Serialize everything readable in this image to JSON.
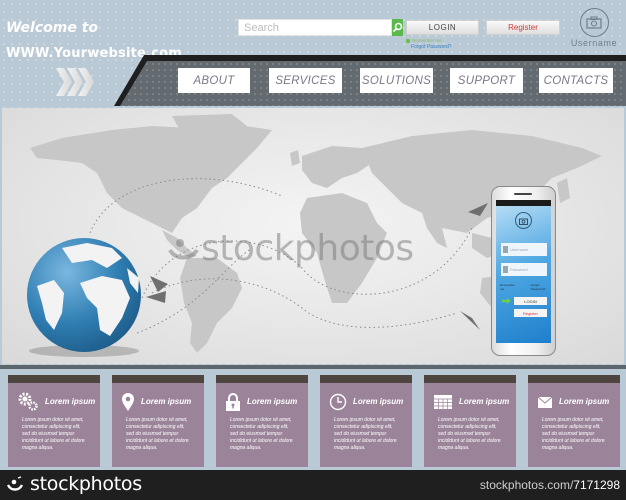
{
  "header": {
    "welcome": "Welcome to",
    "site": "WWW.Yourwebsite.com",
    "search_placeholder": "Search",
    "login_label": "LOGIN",
    "register_label": "Register",
    "remember_label": "Remember me",
    "forgot_label": "Forgot Password?",
    "username_label": "Username"
  },
  "nav": [
    {
      "label": "ABOUT"
    },
    {
      "label": "SERVICES"
    },
    {
      "label": "SOLUTIONS"
    },
    {
      "label": "SUPPORT"
    },
    {
      "label": "CONTACTS"
    }
  ],
  "hero": {
    "watermark": "stockphotos",
    "phone": {
      "username_placeholder": "Username",
      "password_placeholder": "Password",
      "remember_label": "Remember me",
      "forgot_label": "Forgot Password?",
      "login_label": "LOGIN",
      "register_label": "Register"
    }
  },
  "cards": [
    {
      "icon": "gears-icon",
      "title": "Lorem ipsum",
      "text": "Lorem ipsum dolor sit amet, consectetur adipiscing elit, sed do eiusmod tempor incididunt ut labore et dolore magna aliqua."
    },
    {
      "icon": "location-pin-icon",
      "title": "Lorem ipsum",
      "text": "Lorem ipsum dolor sit amet, consectetur adipiscing elit, sed do eiusmod tempor incididunt ut labore et dolore magna aliqua."
    },
    {
      "icon": "lock-icon",
      "title": "Lorem ipsum",
      "text": "Lorem ipsum dolor sit amet, consectetur adipiscing elit, sed do eiusmod tempor incididunt ut labore et dolore magna aliqua."
    },
    {
      "icon": "clock-icon",
      "title": "Lorem ipsum",
      "text": "Lorem ipsum dolor sit amet, consectetur adipiscing elit, sed do eiusmod tempor incididunt ut labore et dolore magna aliqua."
    },
    {
      "icon": "calendar-icon",
      "title": "Lorem ipsum",
      "text": "Lorem ipsum dolor sit amet, consectetur adipiscing elit, sed do eiusmod tempor incididunt ut labore et dolore magna aliqua."
    },
    {
      "icon": "mail-icon",
      "title": "Lorem ipsum",
      "text": "Lorem ipsum dolor sit amet, consectetur adipiscing elit, sed do eiusmod tempor incididunt ut labore et dolore magna aliqua."
    }
  ],
  "footer": {
    "logo": "stockphotos",
    "url_prefix": "stockphotos.com/",
    "url_id": "7171298"
  },
  "colors": {
    "accent_green": "#5ab94a",
    "register_red": "#d23a3a",
    "card_purple": "#9b8499",
    "nav_dark": "#636b71"
  }
}
